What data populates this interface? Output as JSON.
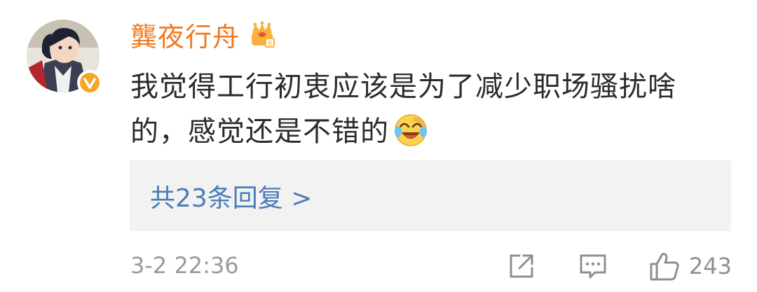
{
  "comment": {
    "username": "龔夜行舟",
    "text": "我觉得工行初衷应该是为了减少职场骚扰啥的，感觉还是不错的",
    "emoji": "laughing-tears-emoji",
    "replies_label": "共23条回复 >",
    "timestamp": "3-2 22:36",
    "like_count": "243"
  },
  "colors": {
    "username": "#f47920",
    "text": "#2b2b2b",
    "link": "#4a7db8",
    "meta": "#9a9a9a",
    "replies_bg": "#f2f2f2",
    "verified": "#f5a623"
  },
  "icons": {
    "verified": "verified-badge-icon",
    "vip": "vip-crown-badge-icon",
    "share": "share-icon",
    "comment": "comment-icon",
    "like": "thumbs-up-icon"
  }
}
